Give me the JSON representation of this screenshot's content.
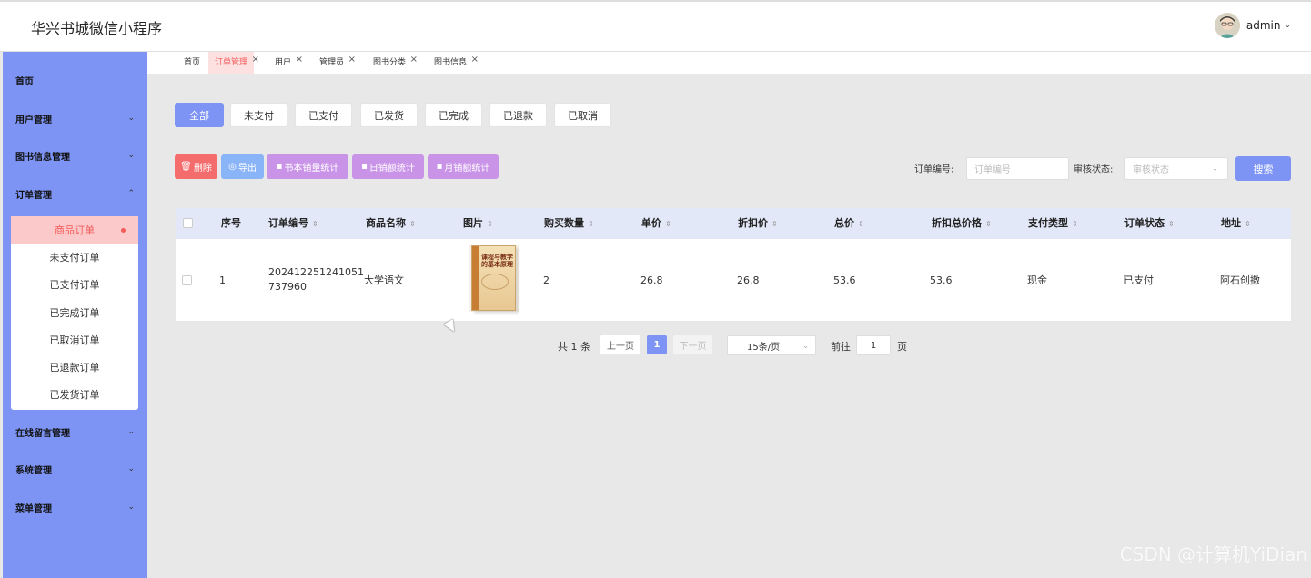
{
  "app": {
    "title": "华兴书城微信小程序",
    "user": "admin"
  },
  "sidebar": {
    "items": [
      {
        "label": "首页",
        "expandable": false
      },
      {
        "label": "用户管理",
        "expandable": true
      },
      {
        "label": "图书信息管理",
        "expandable": true
      },
      {
        "label": "订单管理",
        "expandable": true,
        "expanded": true
      },
      {
        "label": "在线留言管理",
        "expandable": true
      },
      {
        "label": "系统管理",
        "expandable": true
      },
      {
        "label": "菜单管理",
        "expandable": true
      }
    ],
    "order_submenu": [
      {
        "label": "商品订单",
        "active": true
      },
      {
        "label": "未支付订单"
      },
      {
        "label": "已支付订单"
      },
      {
        "label": "已完成订单"
      },
      {
        "label": "已取消订单"
      },
      {
        "label": "已退款订单"
      },
      {
        "label": "已发货订单"
      }
    ]
  },
  "tabs": [
    {
      "label": "首页",
      "closable": false
    },
    {
      "label": "订单管理",
      "closable": true,
      "active": true
    },
    {
      "label": "用户",
      "closable": true
    },
    {
      "label": "管理员",
      "closable": true
    },
    {
      "label": "图书分类",
      "closable": true
    },
    {
      "label": "图书信息",
      "closable": true
    }
  ],
  "status_filters": [
    "全部",
    "未支付",
    "已支付",
    "已发货",
    "已完成",
    "已退款",
    "已取消"
  ],
  "actions": [
    {
      "label": "删除",
      "icon": "trash-icon",
      "color": "#f56c6c"
    },
    {
      "label": "导出",
      "icon": "export-icon",
      "color": "#8ab4f8"
    },
    {
      "label": "书本销量统计",
      "icon": "bar-chart-icon",
      "color": "#c994e8"
    },
    {
      "label": "日销额统计",
      "icon": "bar-chart-icon",
      "color": "#c994e8"
    },
    {
      "label": "月销额统计",
      "icon": "bar-chart-icon",
      "color": "#c994e8"
    }
  ],
  "search": {
    "order_no_label": "订单编号:",
    "order_no_placeholder": "订单编号",
    "status_label": "审核状态:",
    "status_placeholder": "审核状态",
    "button": "搜索"
  },
  "table": {
    "columns": [
      "序号",
      "订单编号",
      "商品名称",
      "图片",
      "购买数量",
      "单价",
      "折扣价",
      "总价",
      "折扣总价格",
      "支付类型",
      "订单状态",
      "地址"
    ],
    "rows": [
      {
        "index": "1",
        "order_no_line1": "202412251241051",
        "order_no_line2": "737960",
        "product": "大学语文",
        "image_title": "课程与教学",
        "image_subtitle": "的基本原理",
        "quantity": "2",
        "price": "26.8",
        "discount_price": "26.8",
        "total": "53.6",
        "discount_total": "53.6",
        "payment": "现金",
        "status": "已支付",
        "address": "阿石创撒"
      }
    ]
  },
  "pagination": {
    "total": "共 1 条",
    "prev": "上一页",
    "current": "1",
    "next": "下一页",
    "page_size": "15条/页",
    "goto_label": "前往",
    "goto_value": "1",
    "page_label": "页"
  },
  "watermark": "CSDN @计算机YiDian",
  "colors": {
    "primary": "#7d94f4",
    "danger": "#f56c6c",
    "active_tab": "#f35a5a"
  }
}
